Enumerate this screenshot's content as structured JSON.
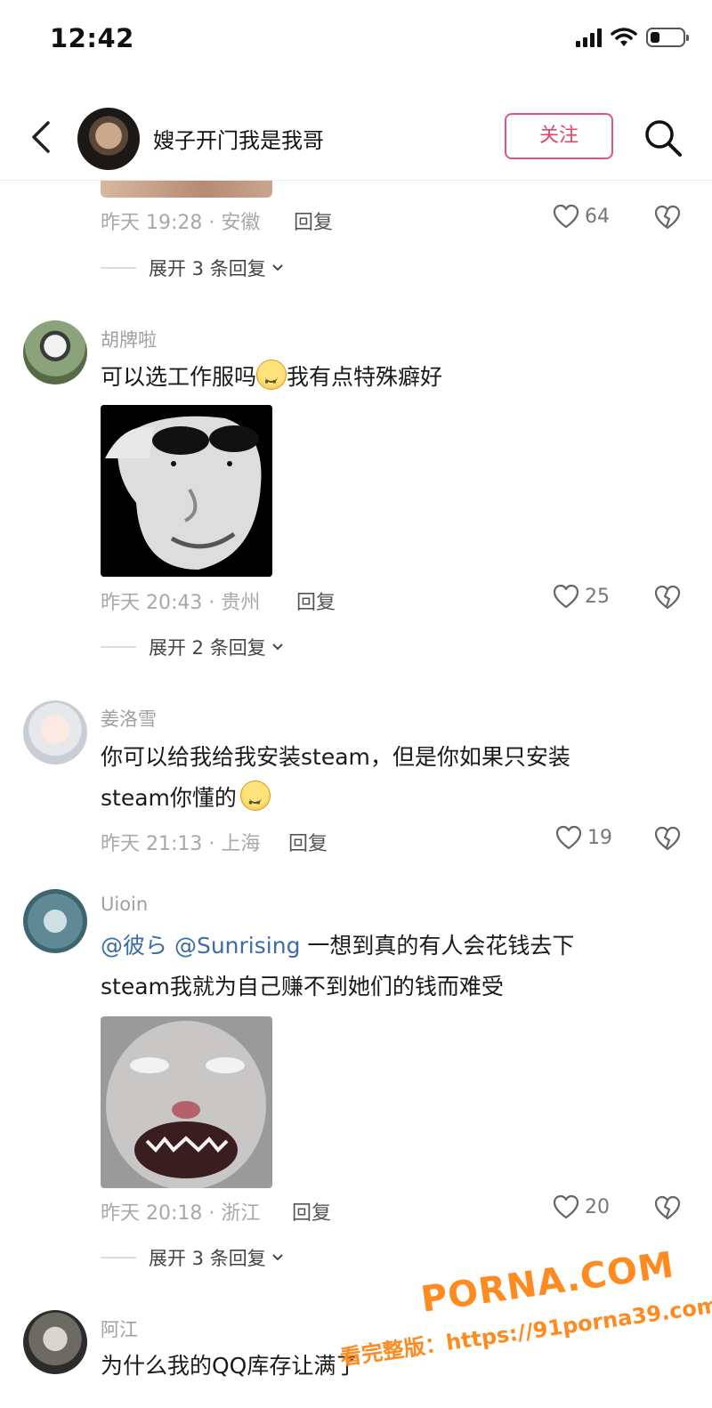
{
  "status_bar": {
    "time": "12:42",
    "battery_level": 0.3
  },
  "header": {
    "title": "嫂子开门我是我哥",
    "follow_label": "关注",
    "icons": [
      "back-arrow-icon",
      "search-icon"
    ]
  },
  "top_comment_tail": {
    "meta": "昨天 19:28 · 安徽",
    "reply_label": "回复",
    "likes": "64",
    "expand_label": "展开 3 条回复"
  },
  "comments": [
    {
      "name": "胡牌啦",
      "text": "可以选工作服吗",
      "text_after_emoji": "我有点特殊癖好",
      "meta": "昨天 20:43 · 贵州",
      "reply_label": "回复",
      "likes": "25",
      "expand_label": "展开 2 条回复"
    },
    {
      "name": "姜洛雪",
      "line1": "你可以给我给我安装steam，但是你如果只安装",
      "line2": "steam你懂的",
      "meta": "昨天 21:13 · 上海",
      "reply_label": "回复",
      "likes": "19"
    },
    {
      "name": "Uioin",
      "mention1": "@彼ら",
      "mention2": "@Sunrising",
      "line1_rest": "一想到真的有人会花钱去下",
      "line2": "steam我就为自己赚不到她们的钱而难受",
      "meta": "昨天 20:18 · 浙江",
      "reply_label": "回复",
      "likes": "20",
      "expand_label": "展开 3 条回复"
    },
    {
      "name": "阿江",
      "text": "为什么我的QQ库存让满了"
    }
  ],
  "watermark": {
    "brand": "PORNA.COM",
    "url_line": "看完整版：https://91porna39.com"
  }
}
